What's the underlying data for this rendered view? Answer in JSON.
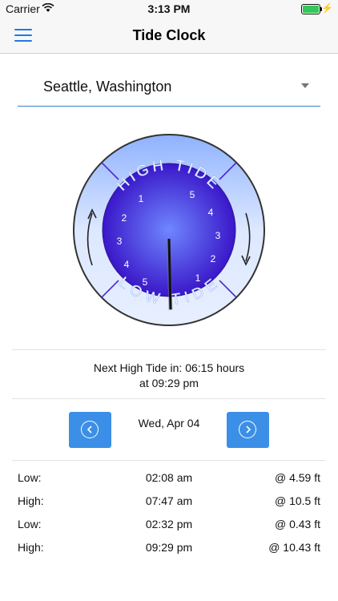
{
  "status_bar": {
    "carrier": "Carrier",
    "time": "3:13 PM"
  },
  "nav": {
    "title": "Tide Clock"
  },
  "location": {
    "selected": "Seattle, Washington"
  },
  "clock": {
    "top_label": "HIGH TIDE",
    "bottom_label": "LOW TIDE",
    "left_numbers": [
      "1",
      "2",
      "3",
      "4",
      "5"
    ],
    "right_numbers": [
      "5",
      "4",
      "3",
      "2",
      "1"
    ],
    "colors": {
      "dial_center": "#6f87ff",
      "dial_edge": "#3a17c9",
      "ring_light": "#e7efff",
      "ring_dark": "#8fb2ff",
      "hand": "#111111"
    }
  },
  "next_tide": {
    "line1": "Next High Tide in: 06:15 hours",
    "line2": "at 09:29 pm"
  },
  "date_nav": {
    "date": "Wed, Apr 04"
  },
  "tides": [
    {
      "type": "Low:",
      "time": "02:08 am",
      "height": "@ 4.59 ft"
    },
    {
      "type": "High:",
      "time": "07:47 am",
      "height": "@ 10.5 ft"
    },
    {
      "type": "Low:",
      "time": "02:32 pm",
      "height": "@ 0.43 ft"
    },
    {
      "type": "High:",
      "time": "09:29 pm",
      "height": "@ 10.43 ft"
    }
  ]
}
